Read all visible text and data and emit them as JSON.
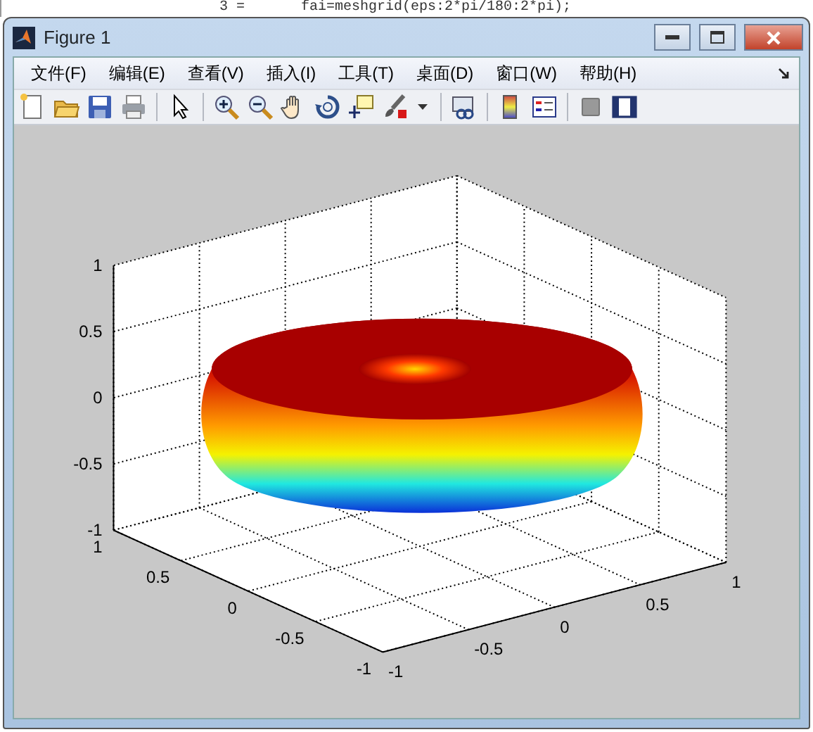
{
  "background_editor": {
    "lines": [
      {
        "label": "3 =",
        "code": "fai=meshgrid(eps:2*pi/180:2*pi);"
      }
    ]
  },
  "window": {
    "title": "Figure 1"
  },
  "menu": [
    "文件(F)",
    "编辑(E)",
    "查看(V)",
    "插入(I)",
    "工具(T)",
    "桌面(D)",
    "窗口(W)",
    "帮助(H)"
  ],
  "axes": {
    "z_ticks": [
      "1",
      "0.5",
      "0",
      "-0.5",
      "-1"
    ],
    "y_ticks": [
      "1",
      "0.5",
      "0",
      "-0.5",
      "-1"
    ],
    "x_ticks": [
      "-1",
      "-0.5",
      "0",
      "0.5",
      "1"
    ]
  }
}
